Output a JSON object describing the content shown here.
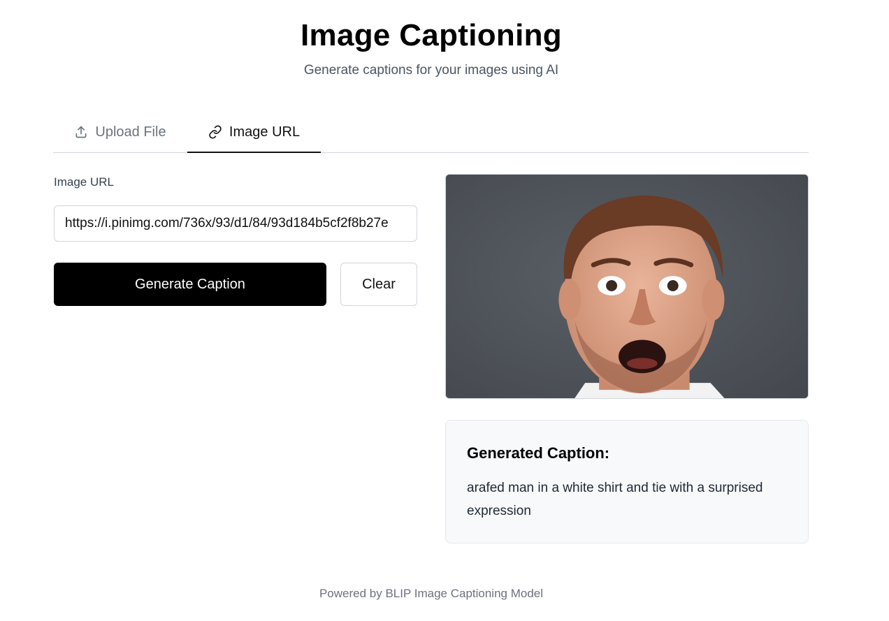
{
  "header": {
    "title": "Image Captioning",
    "subtitle": "Generate captions for your images using AI"
  },
  "tabs": [
    {
      "label": "Upload File",
      "icon": "upload-icon",
      "active": false
    },
    {
      "label": "Image URL",
      "icon": "link-icon",
      "active": true
    }
  ],
  "form": {
    "label": "Image URL",
    "url_value": "https://i.pinimg.com/736x/93/d1/84/93d184b5cf2f8b27e",
    "generate_label": "Generate Caption",
    "clear_label": "Clear"
  },
  "preview": {
    "alt": "surprised-man-photo"
  },
  "result": {
    "heading": "Generated Caption:",
    "caption": "arafed man in a white shirt and tie with a surprised expression"
  },
  "footer": {
    "text": "Powered by BLIP Image Captioning Model"
  },
  "colors": {
    "primary_button": "#000000",
    "active_tab_underline": "#111111",
    "caption_card_bg": "#f8f9fb"
  }
}
